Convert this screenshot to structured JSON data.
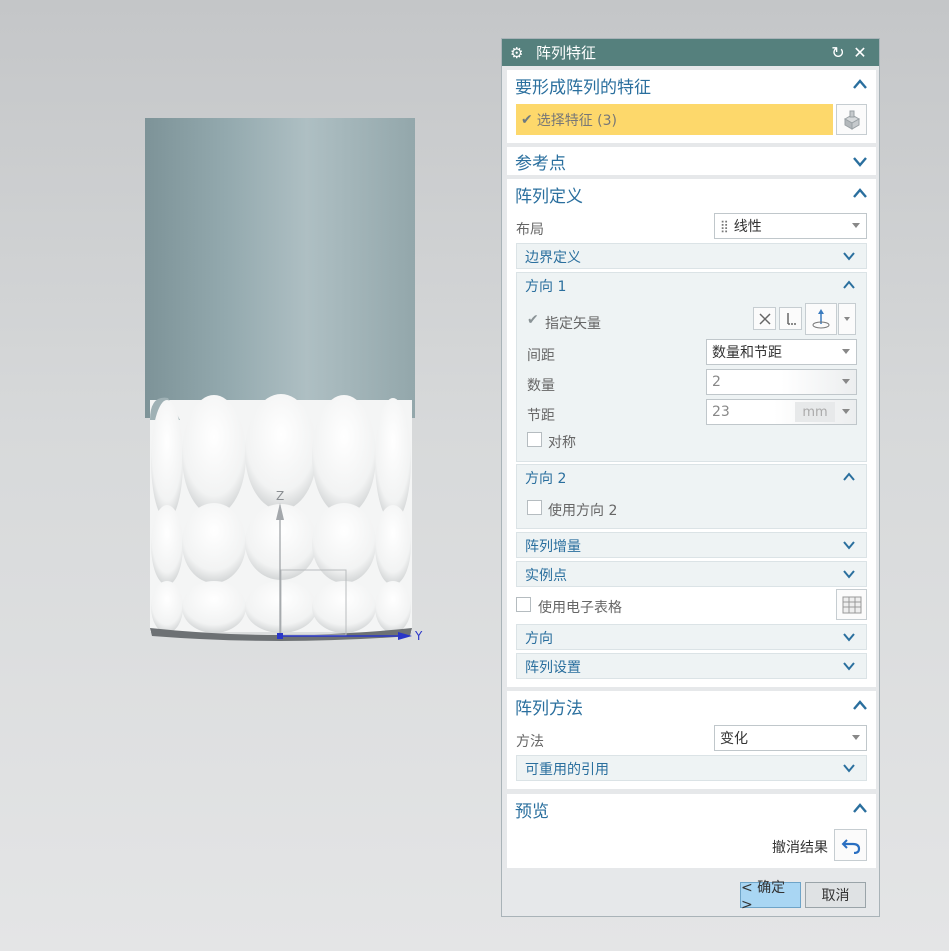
{
  "dialog": {
    "title": "阵列特征",
    "icons": {
      "title": "gear-icon",
      "reset": "reset-icon",
      "close": "close-icon"
    }
  },
  "feature_section": {
    "title": "要形成阵列的特征",
    "select_label": "选择特征 (3)",
    "select_icon": "check-icon",
    "highlight_color": "#fdd86b"
  },
  "reference_section": {
    "title": "参考点"
  },
  "definition_section": {
    "title": "阵列定义",
    "layout_label": "布局",
    "layout_value": "线性",
    "boundary_title": "边界定义",
    "direction1": {
      "title": "方向 1",
      "specify_vector_label": "指定矢量",
      "spacing_label": "间距",
      "spacing_value": "数量和节距",
      "count_label": "数量",
      "count_value": "2",
      "pitch_label": "节距",
      "pitch_value": "23",
      "pitch_unit": "mm",
      "symmetric_label": "对称"
    },
    "direction2": {
      "title": "方向 2",
      "use_label": "使用方向 2"
    },
    "increment_title": "阵列增量",
    "instance_title": "实例点",
    "spreadsheet_label": "使用电子表格",
    "orientation_title": "方向",
    "settings_title": "阵列设置"
  },
  "method_section": {
    "title": "阵列方法",
    "method_label": "方法",
    "method_value": "变化",
    "reusable_title": "可重用的引用"
  },
  "preview_section": {
    "title": "预览",
    "undo_label": "撤消结果"
  },
  "footer": {
    "ok_label": "< 确定 >",
    "cancel_label": "取消"
  },
  "viewport": {
    "axis_z": "Z",
    "axis_y": "Y",
    "model_color": "#9fb3b8"
  },
  "colors": {
    "title_bar": "#55807d",
    "section_heading": "#2a6f9e",
    "ok_button": "#a9d6f3"
  }
}
